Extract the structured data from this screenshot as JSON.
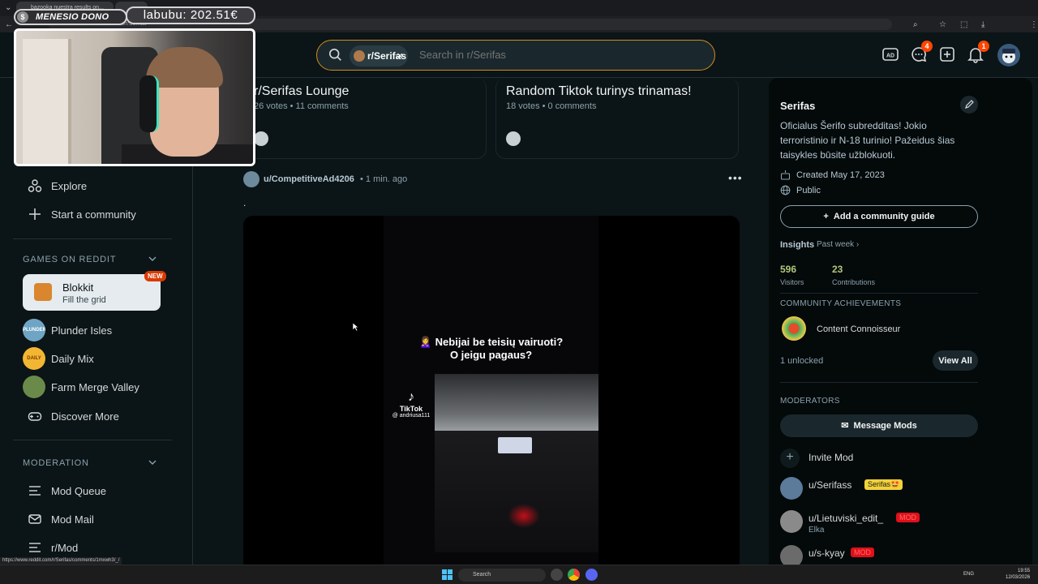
{
  "browser": {
    "tab_label": "bazooka nuestra results on...",
    "url": "reddit.com/r/Serifas"
  },
  "header": {
    "search_chip": "r/Serifas",
    "search_placeholder": "Search in r/Serifas",
    "chat_badge": "4",
    "notif_badge": "1",
    "icons": [
      "advertise-icon",
      "chat-icon",
      "create-post-icon",
      "notification-icon"
    ]
  },
  "sidebar": {
    "nav": [
      {
        "label": "Explore",
        "icon": "explore-icon"
      },
      {
        "label": "Start a community",
        "icon": "plus-icon"
      }
    ],
    "games_header": "GAMES ON REDDIT",
    "featured_game": {
      "title": "Blokkit",
      "subtitle": "Fill the grid",
      "badge": "NEW"
    },
    "games": [
      {
        "label": "Plunder Isles",
        "icon_text": "PLUNDER ISLES",
        "color": "#6fa5c4"
      },
      {
        "label": "Daily Mix",
        "icon_text": "DAILY MIX",
        "color": "#f2b632"
      },
      {
        "label": "Farm Merge Valley",
        "icon_text": "",
        "color": "#6a8a4a"
      }
    ],
    "discover_more": "Discover More",
    "moderation_header": "MODERATION",
    "mod_items": [
      {
        "label": "Mod Queue",
        "icon": "mod-queue-icon"
      },
      {
        "label": "Mod Mail",
        "icon": "mod-mail-icon"
      },
      {
        "label": "r/Mod",
        "icon": "r-mod-icon"
      }
    ]
  },
  "feed": {
    "highlights": [
      {
        "title": "r/Serifas Lounge",
        "meta": "26 votes • 11 comments"
      },
      {
        "title": "Random Tiktok turinys trinamas!",
        "meta": "18 votes • 0 comments"
      }
    ],
    "post": {
      "author": "u/CompetitiveAd4206",
      "time": "• 1 min. ago",
      "body": ".",
      "video_caption_line1": "🙎‍♀️ Nebijai be teisių vairuoti?",
      "video_caption_line2": "O jeigu pagaus?",
      "tiktok_brand": "TikTok",
      "tiktok_handle": "@ andriusa111"
    }
  },
  "community": {
    "name": "Serifas",
    "description": "Oficialus Šerifo subredditas! Jokio terroristinio ir N-18 turinio! Pažeidus šias taisykles būsite užblokuoti.",
    "created": "Created May 17, 2023",
    "visibility": "Public",
    "guide_button": "Add a community guide",
    "insights_label": "Insights",
    "insights_period": "Past week ›",
    "stats": [
      {
        "value": "596",
        "label": "Visitors"
      },
      {
        "value": "23",
        "label": "Contributions"
      }
    ],
    "achievements_header": "COMMUNITY ACHIEVEMENTS",
    "achievement": "Content Connoisseur",
    "unlocked": "1 unlocked",
    "view_all": "View All",
    "moderators_header": "MODERATORS",
    "message_mods": "Message Mods",
    "invite_mod": "Invite Mod",
    "mods": [
      {
        "name": "u/Serifass",
        "flair": "Serifas🤩",
        "flair_bg": "#f2d23a",
        "flair_fg": "#1a1a1a",
        "sub": ""
      },
      {
        "name": "u/Lietuviski_edit_",
        "flair": "MOD",
        "flair_bg": "#e0101a",
        "flair_fg": "#ff6a6a",
        "sub": "Elka"
      },
      {
        "name": "u/s-kyay",
        "flair": "MOD",
        "flair_bg": "#e0101a",
        "flair_fg": "#ff6a6a",
        "sub": ""
      }
    ]
  },
  "overlay": {
    "donor_label": "MENESIO DONO",
    "donor_value": "labubu: 202.51€"
  },
  "status_url": "https://www.reddit.com/r/Serifas/comments/1mxwh3/_/",
  "taskbar": {
    "search": "Search",
    "lang": "ENG",
    "time": "19:55",
    "date": "12/03/2026"
  }
}
